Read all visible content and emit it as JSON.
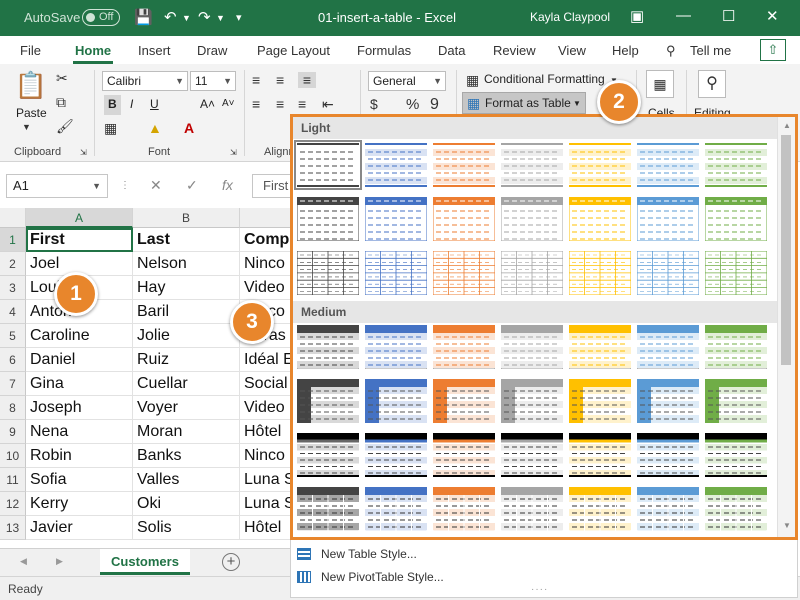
{
  "titlebar": {
    "autosave_label": "AutoSave",
    "autosave_state": "Off",
    "document_title": "01-insert-a-table  -  Excel",
    "user_name": "Kayla Claypool"
  },
  "ribbon_tabs": [
    {
      "label": "File",
      "active": false
    },
    {
      "label": "Home",
      "active": true
    },
    {
      "label": "Insert",
      "active": false
    },
    {
      "label": "Draw",
      "active": false
    },
    {
      "label": "Page Layout",
      "active": false
    },
    {
      "label": "Formulas",
      "active": false
    },
    {
      "label": "Data",
      "active": false
    },
    {
      "label": "Review",
      "active": false
    },
    {
      "label": "View",
      "active": false
    },
    {
      "label": "Help",
      "active": false
    }
  ],
  "tell_me": "Tell me",
  "ribbon": {
    "clipboard_label": "Clipboard",
    "paste_label": "Paste",
    "font_label": "Font",
    "font_name": "Calibri",
    "font_size": "11",
    "alignment_label": "Alignm",
    "number_format": "General",
    "conditional_formatting": "Conditional Formatting",
    "format_as_table": "Format as Table",
    "cells_label": "Cells",
    "editing_label": "Editing"
  },
  "formula_bar": {
    "name_box": "A1",
    "content": "First"
  },
  "sheet": {
    "columns": [
      "A",
      "B"
    ],
    "row_numbers": [
      "1",
      "2",
      "3",
      "4",
      "5",
      "6",
      "7",
      "8",
      "9",
      "10",
      "11",
      "12",
      "13"
    ],
    "header": [
      "First",
      "Last",
      "Comp"
    ],
    "rows": [
      [
        "Joel",
        "Nelson",
        "Ninco"
      ],
      [
        "Loui",
        "Hay",
        "Video"
      ],
      [
        "Anton",
        "Baril",
        "Ninco"
      ],
      [
        "Caroline",
        "Jolie",
        "Ultras"
      ],
      [
        "Daniel",
        "Ruiz",
        "Idéal E"
      ],
      [
        "Gina",
        "Cuellar",
        "Social"
      ],
      [
        "Joseph",
        "Voyer",
        "Video"
      ],
      [
        "Nena",
        "Moran",
        "Hôtel"
      ],
      [
        "Robin",
        "Banks",
        "Ninco"
      ],
      [
        "Sofia",
        "Valles",
        "Luna S"
      ],
      [
        "Kerry",
        "Oki",
        "Luna S"
      ],
      [
        "Javier",
        "Solis",
        "Hôtel"
      ]
    ],
    "active_sheet": "Customers"
  },
  "gallery": {
    "light_label": "Light",
    "medium_label": "Medium",
    "footer_new_table_style": "New Table Style...",
    "footer_new_pivot_style": "New PivotTable Style...",
    "style_colors": [
      "#000000",
      "#4472c4",
      "#ed7d31",
      "#a5a5a5",
      "#ffc000",
      "#5b9bd5",
      "#70ad47"
    ]
  },
  "status": {
    "ready": "Ready"
  },
  "callouts": [
    "1",
    "2",
    "3"
  ]
}
